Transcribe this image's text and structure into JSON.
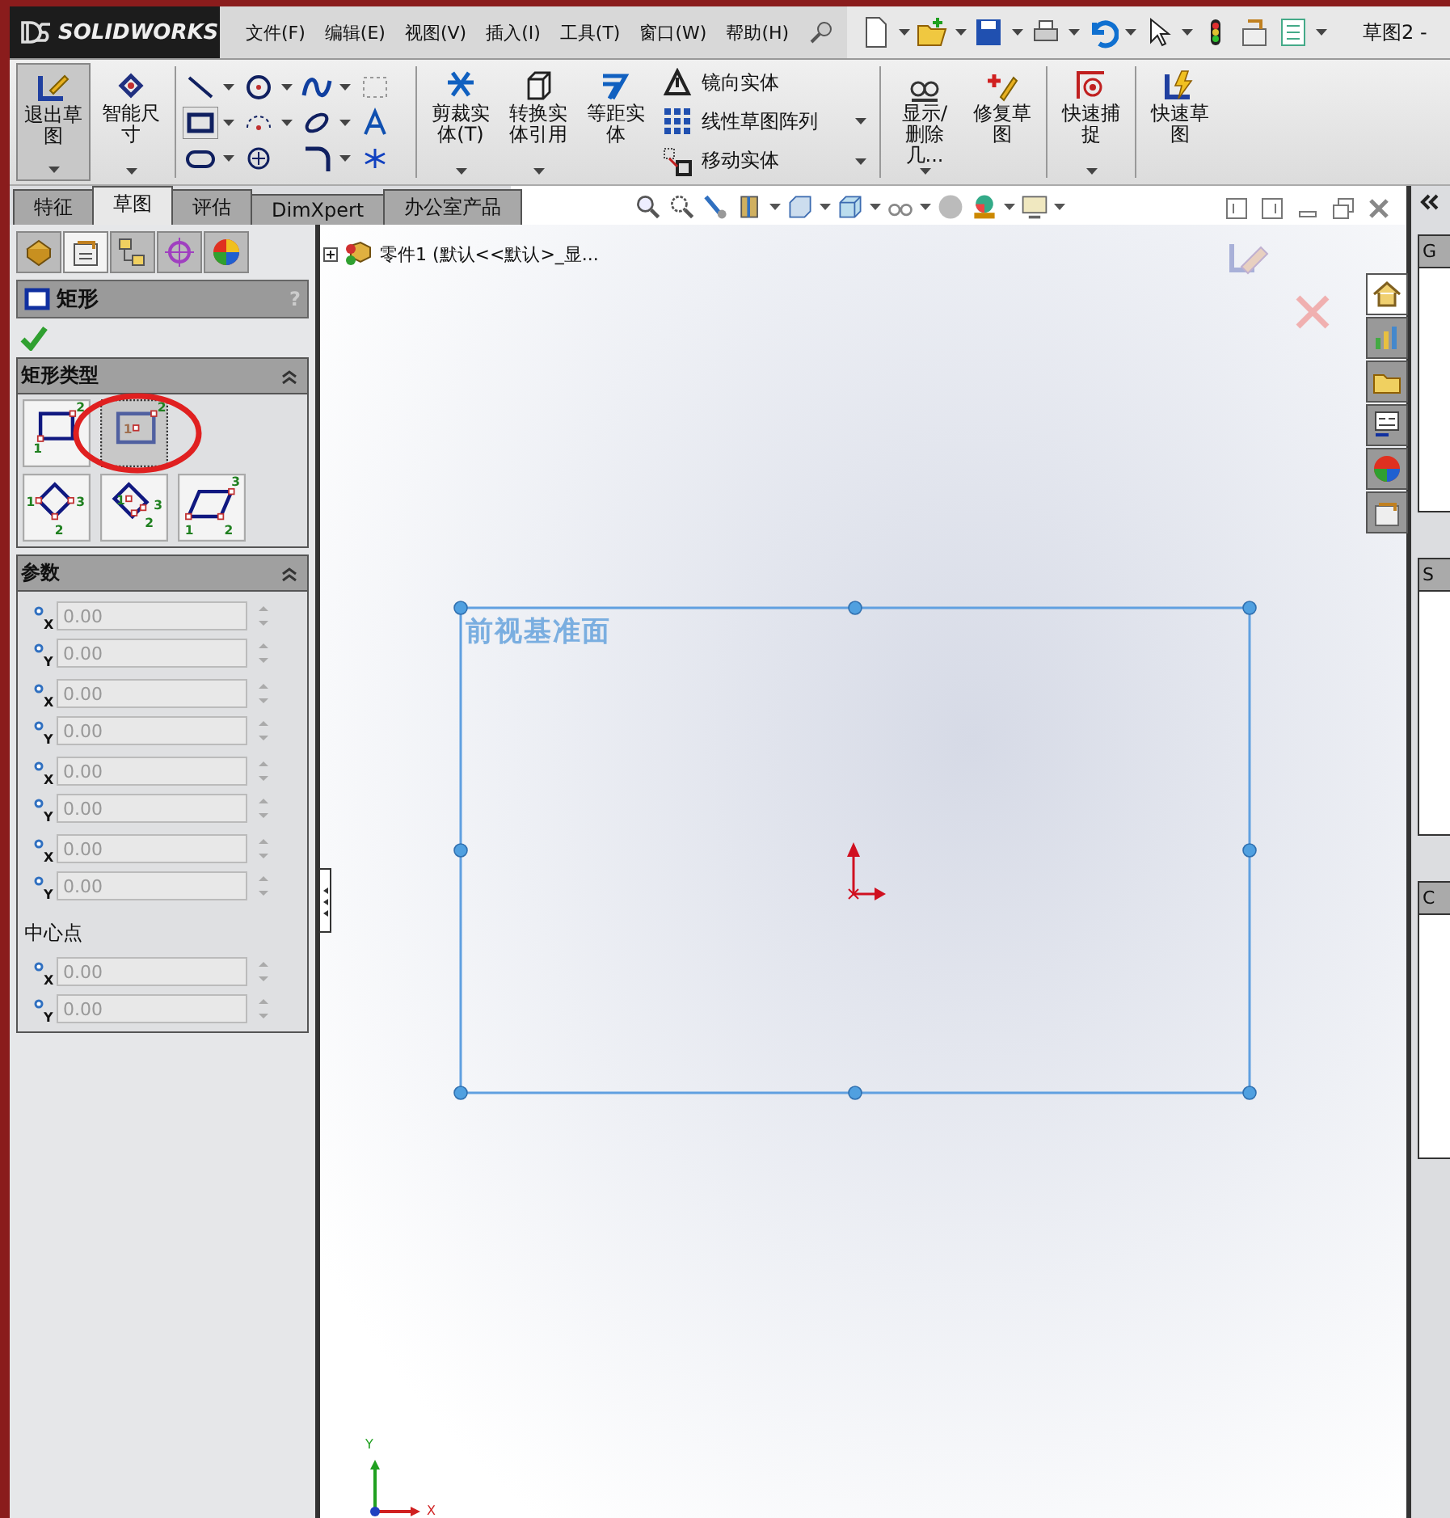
{
  "app": {
    "logo": "SOLIDWORKS",
    "menu": [
      "文件(F)",
      "编辑(E)",
      "视图(V)",
      "插入(I)",
      "工具(T)",
      "窗口(W)",
      "帮助(H)"
    ],
    "document_title": "草图2 -"
  },
  "ribbon": {
    "sections": [
      [
        {
          "kind": "large",
          "label": "退出草图",
          "pressed": true,
          "dropdown": true
        },
        {
          "kind": "large",
          "label": "智能尺寸",
          "pressed": false,
          "dropdown": true
        }
      ],
      [
        {
          "kind": "entities",
          "tools": [
            {
              "selected": false,
              "dropdown": true
            },
            {
              "selected": false,
              "dropdown": true
            },
            {
              "selected": false,
              "dropdown": true
            },
            {
              "selected": false,
              "dropdown": false
            },
            {
              "selected": true,
              "dropdown": true
            },
            {
              "selected": false,
              "dropdown": true
            },
            {
              "selected": false,
              "dropdown": true
            },
            {
              "selected": false,
              "dropdown": false
            },
            {
              "selected": false,
              "dropdown": true
            },
            {
              "selected": false,
              "dropdown": false
            },
            {
              "selected": false,
              "dropdown": true
            },
            {
              "selected": false,
              "dropdown": false
            }
          ]
        }
      ],
      [
        {
          "kind": "large",
          "label": "剪裁实体(T)",
          "pressed": false,
          "dropdown": true
        },
        {
          "kind": "large",
          "label": "转换实体引用",
          "pressed": false,
          "dropdown": true
        },
        {
          "kind": "large",
          "label": "等距实体",
          "pressed": false,
          "dropdown": false
        },
        {
          "kind": "stack",
          "items": [
            {
              "label": "镜向实体",
              "dropdown": false
            },
            {
              "label": "线性草图阵列",
              "dropdown": true
            },
            {
              "label": "移动实体",
              "dropdown": true
            }
          ]
        }
      ],
      [
        {
          "kind": "large",
          "label": "显示/删除几...",
          "pressed": false,
          "dropdown": true
        },
        {
          "kind": "large",
          "label": "修复草图",
          "pressed": false,
          "dropdown": false
        }
      ],
      [
        {
          "kind": "large",
          "label": "快速捕捉",
          "pressed": false,
          "dropdown": true
        }
      ],
      [
        {
          "kind": "large",
          "label": "快速草图",
          "pressed": false,
          "dropdown": false
        }
      ]
    ]
  },
  "command_tabs": [
    {
      "label": "特征",
      "selected": false
    },
    {
      "label": "草图",
      "selected": true
    },
    {
      "label": "评估",
      "selected": false
    },
    {
      "label": "DimXpert",
      "selected": false
    },
    {
      "label": "办公室产品",
      "selected": false
    }
  ],
  "manager_tabs": [
    {
      "selected": false
    },
    {
      "selected": true
    },
    {
      "selected": false
    },
    {
      "selected": false
    },
    {
      "selected": false
    }
  ],
  "property_manager": {
    "title": "矩形",
    "help": "?",
    "rect_type": {
      "title": "矩形类型",
      "types": [
        {
          "kind": "corner",
          "selected": false,
          "labels": [
            "1",
            "2"
          ]
        },
        {
          "kind": "center",
          "selected": true,
          "labels": [
            "1",
            "2"
          ]
        },
        {
          "kind": "corner3",
          "selected": false,
          "labels": [
            "1",
            "2",
            "3"
          ]
        },
        {
          "kind": "center3",
          "selected": false,
          "labels": [
            "1",
            "2",
            "3"
          ]
        },
        {
          "kind": "parallelogram",
          "selected": false,
          "labels": [
            "1",
            "2",
            "3"
          ]
        }
      ]
    },
    "parameters": {
      "title": "参数",
      "groups": [
        {
          "fields": [
            {
              "axis": "X",
              "value": "0.00",
              "disabled": true
            },
            {
              "axis": "Y",
              "value": "0.00",
              "disabled": true
            }
          ]
        },
        {
          "fields": [
            {
              "axis": "X",
              "value": "0.00",
              "disabled": true
            },
            {
              "axis": "Y",
              "value": "0.00",
              "disabled": true
            }
          ]
        },
        {
          "fields": [
            {
              "axis": "X",
              "value": "0.00",
              "disabled": true
            },
            {
              "axis": "Y",
              "value": "0.00",
              "disabled": true
            }
          ]
        },
        {
          "fields": [
            {
              "axis": "X",
              "value": "0.00",
              "disabled": true
            },
            {
              "axis": "Y",
              "value": "0.00",
              "disabled": true
            }
          ]
        },
        {
          "label": "中心点",
          "fields": [
            {
              "axis": "X",
              "value": "0.00",
              "disabled": true
            },
            {
              "axis": "Y",
              "value": "0.00",
              "disabled": true
            }
          ]
        }
      ]
    }
  },
  "tree": {
    "label": "零件1  (默认<<默认>_显..."
  },
  "canvas": {
    "plane_label": "前视基准面",
    "triad": [
      "Y",
      "X"
    ]
  },
  "task_pane": {
    "tabs": [
      {
        "selected": true
      },
      {
        "selected": false
      },
      {
        "selected": false
      },
      {
        "selected": false
      },
      {
        "selected": false
      },
      {
        "selected": false
      }
    ],
    "sections": [
      "G",
      "S",
      "C"
    ]
  }
}
